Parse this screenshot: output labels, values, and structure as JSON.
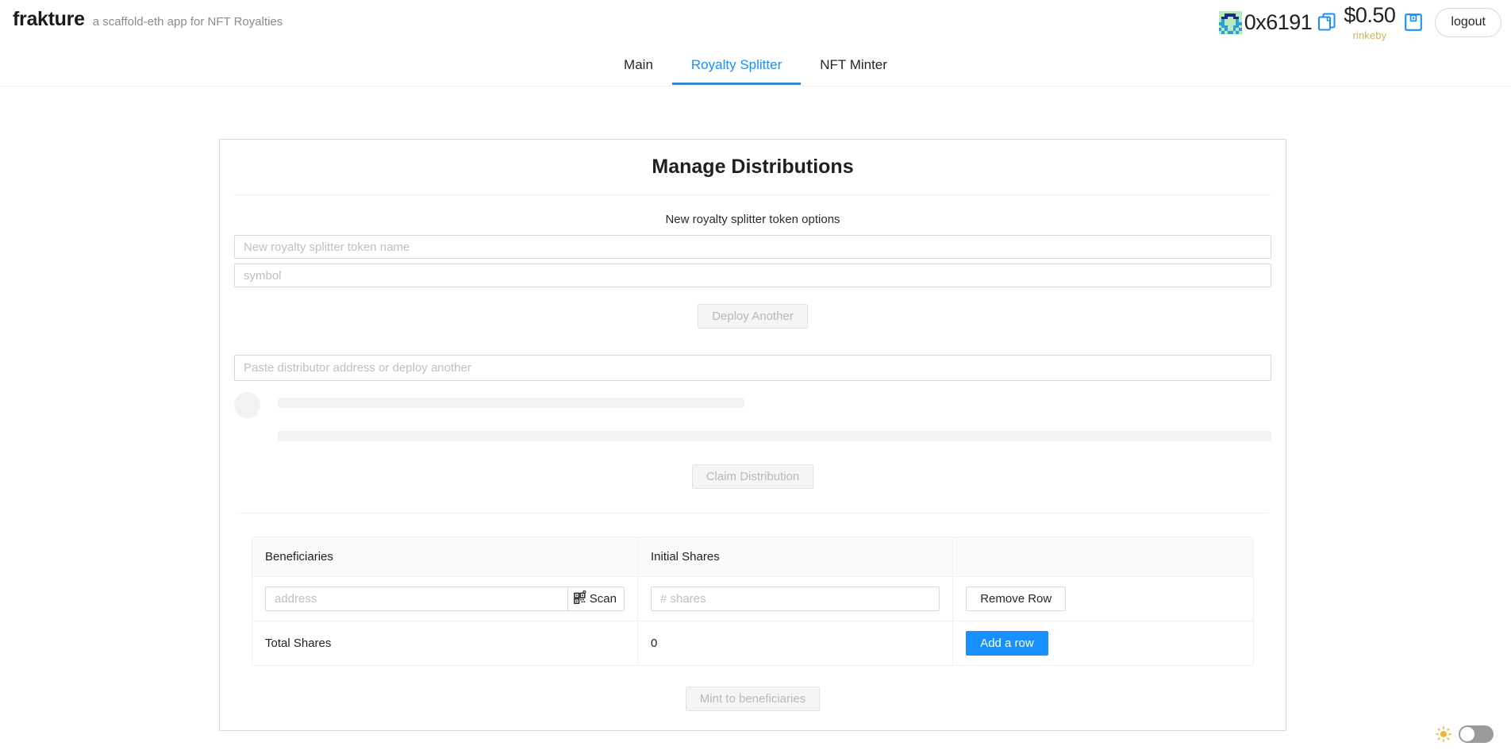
{
  "header": {
    "brand": "frakture",
    "tagline": "a scaffold-eth app for NFT Royalties",
    "account": {
      "address_short": "0x6191",
      "balance": "$0.50",
      "network": "rinkeby",
      "logout_label": "logout",
      "copy_icon": "copy-icon",
      "wallet_icon": "wallet-save-icon",
      "blockie_colors": {
        "bg": "#b8e8c0",
        "fg": "#1b2a8c",
        "spot": "#2f9fd0"
      }
    }
  },
  "nav": {
    "tabs": [
      {
        "label": "Main",
        "active": false
      },
      {
        "label": "Royalty Splitter",
        "active": true
      },
      {
        "label": "NFT Minter",
        "active": false
      }
    ],
    "active_color": "#1890ff",
    "underline_color": "#3b86c8"
  },
  "card": {
    "title": "Manage Distributions",
    "token_options": {
      "section_label": "New royalty splitter token options",
      "name_placeholder": "New royalty splitter token name",
      "name_value": "",
      "symbol_placeholder": "symbol",
      "symbol_value": "",
      "deploy_label": "Deploy Another",
      "deploy_disabled": true
    },
    "distributor": {
      "placeholder": "Paste distributor address or deploy another",
      "value": "",
      "loading_skeleton": true
    },
    "claim": {
      "label": "Claim Distribution",
      "disabled": true
    },
    "table": {
      "columns": [
        "Beneficiaries",
        "Initial Shares",
        ""
      ],
      "rows": [
        {
          "address_placeholder": "address",
          "address_value": "",
          "scan_label": "Scan",
          "scan_icon": "qr-code-icon",
          "shares_placeholder": "# shares",
          "shares_value": "",
          "remove_label": "Remove Row"
        }
      ],
      "footer": {
        "label": "Total Shares",
        "total": "0",
        "add_row_label": "Add a row"
      }
    },
    "mint": {
      "label": "Mint to beneficiaries",
      "disabled": true
    }
  },
  "theme": {
    "sun_icon": "sun-icon",
    "toggle_on": false,
    "track_color": "#9b9b9b"
  }
}
